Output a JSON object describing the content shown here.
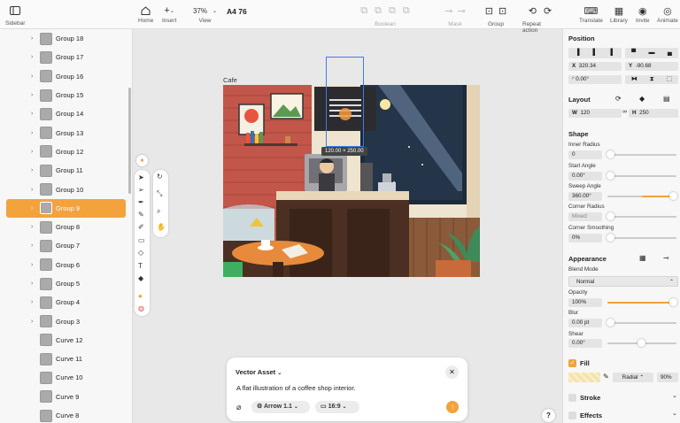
{
  "toolbar": {
    "sidebar": "Sidebar",
    "home": "Home",
    "insert": "Insert",
    "zoom": "37%",
    "view": "View",
    "doc_title": "A4 76",
    "boolean": "Boolean",
    "mask": "Mask",
    "group": "Group",
    "repeat": "Repeat action",
    "translate": "Translate",
    "library": "Library",
    "invite": "Invite",
    "animate": "Animate"
  },
  "layers": [
    {
      "name": "Group 18",
      "chevron": "›"
    },
    {
      "name": "Group 17",
      "chevron": "›"
    },
    {
      "name": "Group 16",
      "chevron": "›"
    },
    {
      "name": "Group 15",
      "chevron": "›"
    },
    {
      "name": "Group 14",
      "chevron": "›"
    },
    {
      "name": "Group 13",
      "chevron": "›"
    },
    {
      "name": "Group 12",
      "chevron": "›"
    },
    {
      "name": "Group 11",
      "chevron": "›"
    },
    {
      "name": "Group 10",
      "chevron": "›"
    },
    {
      "name": "Group 9",
      "chevron": "›",
      "selected": true
    },
    {
      "name": "Group 8",
      "chevron": "›"
    },
    {
      "name": "Group 7",
      "chevron": "›"
    },
    {
      "name": "Group 6",
      "chevron": "›"
    },
    {
      "name": "Group 5",
      "chevron": "›"
    },
    {
      "name": "Group 4",
      "chevron": "›"
    },
    {
      "name": "Group 3",
      "chevron": "›"
    },
    {
      "name": "Curve 12",
      "chevron": ""
    },
    {
      "name": "Curve 11",
      "chevron": ""
    },
    {
      "name": "Curve 10",
      "chevron": ""
    },
    {
      "name": "Curve 9",
      "chevron": ""
    },
    {
      "name": "Curve 8",
      "chevron": ""
    }
  ],
  "canvas": {
    "artboard_label": "Cafe",
    "selection_size": "120.00 × 250.00"
  },
  "inspector": {
    "position_title": "Position",
    "x_label": "X",
    "x": "320.34",
    "y_label": "Y",
    "y": "-90.68",
    "rotation": "0.00°",
    "layout_title": "Layout",
    "w_label": "W",
    "w": "120",
    "h_label": "H",
    "h": "250",
    "shape_title": "Shape",
    "inner_radius_label": "Inner Radius",
    "inner_radius": "0",
    "start_angle_label": "Start Angle",
    "start_angle": "0.00°",
    "sweep_angle_label": "Sweep Angle",
    "sweep_angle": "360.00°",
    "corner_radius_label": "Corner Radius",
    "corner_radius": "Mixed",
    "corner_smoothing_label": "Corner Smoothing",
    "corner_smoothing": "0%",
    "appearance_title": "Appearance",
    "blend_mode_label": "Blend Mode",
    "blend_mode": "Normal",
    "opacity_label": "Opacity",
    "opacity": "100%",
    "blur_label": "Blur",
    "blur": "0.00 pt",
    "shear_label": "Shear",
    "shear": "0.00°",
    "fill_title": "Fill",
    "fill_type": "Radial",
    "fill_opacity": "90%",
    "stroke_title": "Stroke",
    "effects_title": "Effects",
    "accent": "#f3a23c"
  },
  "prompt": {
    "mode": "Vector Asset",
    "text": "A flat illustration of a coffee shop interior.",
    "model": "Arrow 1.1",
    "ratio": "16:9",
    "help": "?"
  }
}
